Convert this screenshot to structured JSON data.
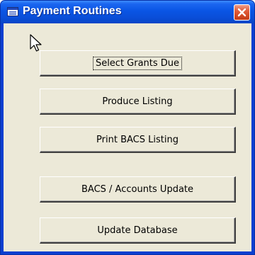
{
  "window": {
    "title": "Payment Routines",
    "close_icon": "close-x-icon",
    "app_icon": "form-window-icon"
  },
  "buttons": [
    {
      "label": "Select Grants Due",
      "focused": true
    },
    {
      "label": "Produce Listing"
    },
    {
      "label": "Print BACS Listing"
    },
    {
      "label": "BACS / Accounts Update"
    },
    {
      "label": "Update Database"
    }
  ],
  "colors": {
    "title_bar": "#0a55e4",
    "close_button": "#d34a24",
    "dialog_face": "#ece9d8"
  }
}
